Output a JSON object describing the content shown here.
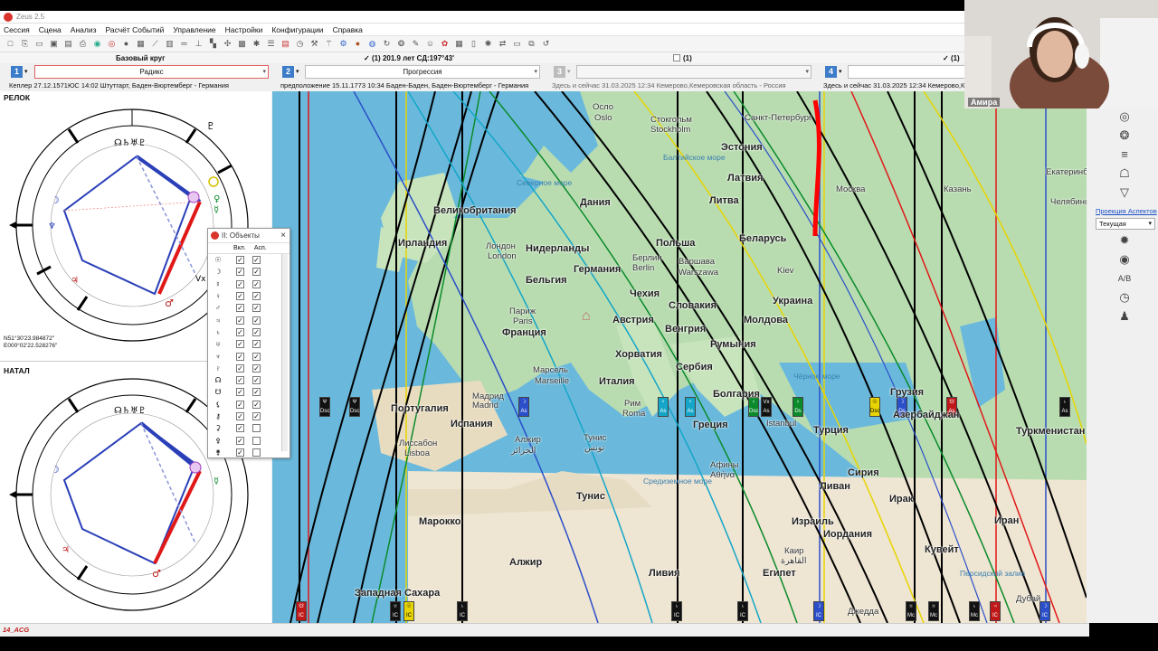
{
  "app": {
    "title": "Zeus 2.5"
  },
  "menu": [
    "Сессия",
    "Сцена",
    "Анализ",
    "Расчёт Событий",
    "Управление",
    "Настройки",
    "Конфигурации",
    "Справка"
  ],
  "header": {
    "base_circle": "Базовый круг",
    "slot1_check": "(1) 201.9 лет СД:197°43'",
    "slot3_check": "(1)",
    "slot4_check": "(1)"
  },
  "slots": [
    {
      "num": "1",
      "select": "Радикс",
      "info": "Кеплер 27.12.1571ЮС 14:02 Штутгарт, Баден-Вюртемберг - Германия"
    },
    {
      "num": "2",
      "select": "Прогрессия",
      "info": "предположение 15.11.1773 10:34 Баден-Баден, Баден-Вюртемберг - Германия"
    },
    {
      "num": "3",
      "select": "",
      "info": "Здесь и сейчас 31.03.2025 12:34 Кемерово,Кемеровская область - Россия"
    },
    {
      "num": "4",
      "select": "",
      "info": "Здесь и сейчас 31.03.2025 12:34 Кемерово,Кем"
    }
  ],
  "charts": {
    "top_label": "РЕЛОК",
    "top_coords": [
      "N51°30'23.984872\"",
      "E000°02'22.528276\""
    ],
    "bottom_label": "НАТАЛ"
  },
  "objects_window": {
    "title": "II: Объекты",
    "col_on": "Вкл.",
    "col_asp": "Асп.",
    "rows": [
      {
        "glyph": "☉",
        "on": true,
        "asp": true
      },
      {
        "glyph": "☽",
        "on": true,
        "asp": true
      },
      {
        "glyph": "☿",
        "on": true,
        "asp": true
      },
      {
        "glyph": "♀",
        "on": true,
        "asp": true
      },
      {
        "glyph": "♂",
        "on": true,
        "asp": true
      },
      {
        "glyph": "♃",
        "on": true,
        "asp": true
      },
      {
        "glyph": "♄",
        "on": true,
        "asp": true
      },
      {
        "glyph": "♅",
        "on": true,
        "asp": true
      },
      {
        "glyph": "♆",
        "on": true,
        "asp": true
      },
      {
        "glyph": "♇",
        "on": true,
        "asp": true
      },
      {
        "glyph": "☊",
        "on": true,
        "asp": true
      },
      {
        "glyph": "☋",
        "on": true,
        "asp": true
      },
      {
        "glyph": "⚸",
        "on": true,
        "asp": true
      },
      {
        "glyph": "⚷",
        "on": true,
        "asp": true
      },
      {
        "glyph": "⚳",
        "on": true,
        "asp": false
      },
      {
        "glyph": "⚴",
        "on": true,
        "asp": false
      },
      {
        "glyph": "⚵",
        "on": true,
        "asp": false
      }
    ]
  },
  "map": {
    "labels": [
      {
        "t": "Осло"
      },
      {
        "t": "Oslo"
      },
      {
        "t": "Стокгольм"
      },
      {
        "t": "Stockholm"
      },
      {
        "t": "Санкт-Петербург"
      },
      {
        "t": "Эстония"
      },
      {
        "t": "Латвия"
      },
      {
        "t": "Литва"
      },
      {
        "t": "Москва"
      },
      {
        "t": "Казань"
      },
      {
        "t": "Екатеринбург"
      },
      {
        "t": "Челябинск"
      },
      {
        "t": "Великобритания"
      },
      {
        "t": "Ирландия"
      },
      {
        "t": "Дания"
      },
      {
        "t": "Нидерланды"
      },
      {
        "t": "Лондон"
      },
      {
        "t": "London"
      },
      {
        "t": "Германия"
      },
      {
        "t": "Бельгия"
      },
      {
        "t": "Польша"
      },
      {
        "t": "Берлин"
      },
      {
        "t": "Berlin"
      },
      {
        "t": "Варшава"
      },
      {
        "t": "Warszawa"
      },
      {
        "t": "Беларусь"
      },
      {
        "t": "Kiev"
      },
      {
        "t": "Украина"
      },
      {
        "t": "Чехия"
      },
      {
        "t": "Словакия"
      },
      {
        "t": "Париж"
      },
      {
        "t": "Paris"
      },
      {
        "t": "Франция"
      },
      {
        "t": "Австрия"
      },
      {
        "t": "Венгрия"
      },
      {
        "t": "Молдова"
      },
      {
        "t": "Румыния"
      },
      {
        "t": "Marseille"
      },
      {
        "t": "Марсель"
      },
      {
        "t": "Хорватия"
      },
      {
        "t": "Сербия"
      },
      {
        "t": "Италия"
      },
      {
        "t": "Болгария"
      },
      {
        "t": "Чёрное море"
      },
      {
        "t": "Грузия"
      },
      {
        "t": "Азербайджан"
      },
      {
        "t": "Португалия"
      },
      {
        "t": "Мадрид"
      },
      {
        "t": "Madrid"
      },
      {
        "t": "Испания"
      },
      {
        "t": "Рим"
      },
      {
        "t": "Roma"
      },
      {
        "t": "Греция"
      },
      {
        "t": "Istanbul"
      },
      {
        "t": "Турция"
      },
      {
        "t": "Туркменистан"
      },
      {
        "t": "Лиссабон"
      },
      {
        "t": "Lisboa"
      },
      {
        "t": "Алжир"
      },
      {
        "t": "الجزائر"
      },
      {
        "t": "Тунис"
      },
      {
        "t": "تونس"
      },
      {
        "t": "Афины"
      },
      {
        "t": "Αθήνα"
      },
      {
        "t": "Средиземное море"
      },
      {
        "t": "Сирия"
      },
      {
        "t": "Ливан"
      },
      {
        "t": "Ирак"
      },
      {
        "t": "Иран"
      },
      {
        "t": "Израиль"
      },
      {
        "t": "Иордания"
      },
      {
        "t": "Кувейт"
      },
      {
        "t": "Марокко"
      },
      {
        "t": "Алжир"
      },
      {
        "t": "Ливия"
      },
      {
        "t": "Египет"
      },
      {
        "t": "Каир"
      },
      {
        "t": "القاهرة"
      },
      {
        "t": "Западная Сахара"
      },
      {
        "t": "Джедда"
      },
      {
        "t": "Дубай"
      },
      {
        "t": "Персидский залив"
      },
      {
        "t": "Северное море"
      },
      {
        "t": "Балтийское море"
      },
      {
        "t": "Тунис"
      }
    ]
  },
  "rightpanel": {
    "link": "Проекция Аспектов",
    "select": "Текущая"
  },
  "webcam": {
    "name": "Амира"
  },
  "status": {
    "text": "14_ACG"
  },
  "colors": {
    "accent": "#3d7cc9",
    "red_line": "#e01818",
    "black_line": "#000000",
    "green_line": "#0a8a2a",
    "teal_line": "#14a6c8",
    "blue_line": "#2a4fc8",
    "yellow_line": "#e8d400"
  }
}
